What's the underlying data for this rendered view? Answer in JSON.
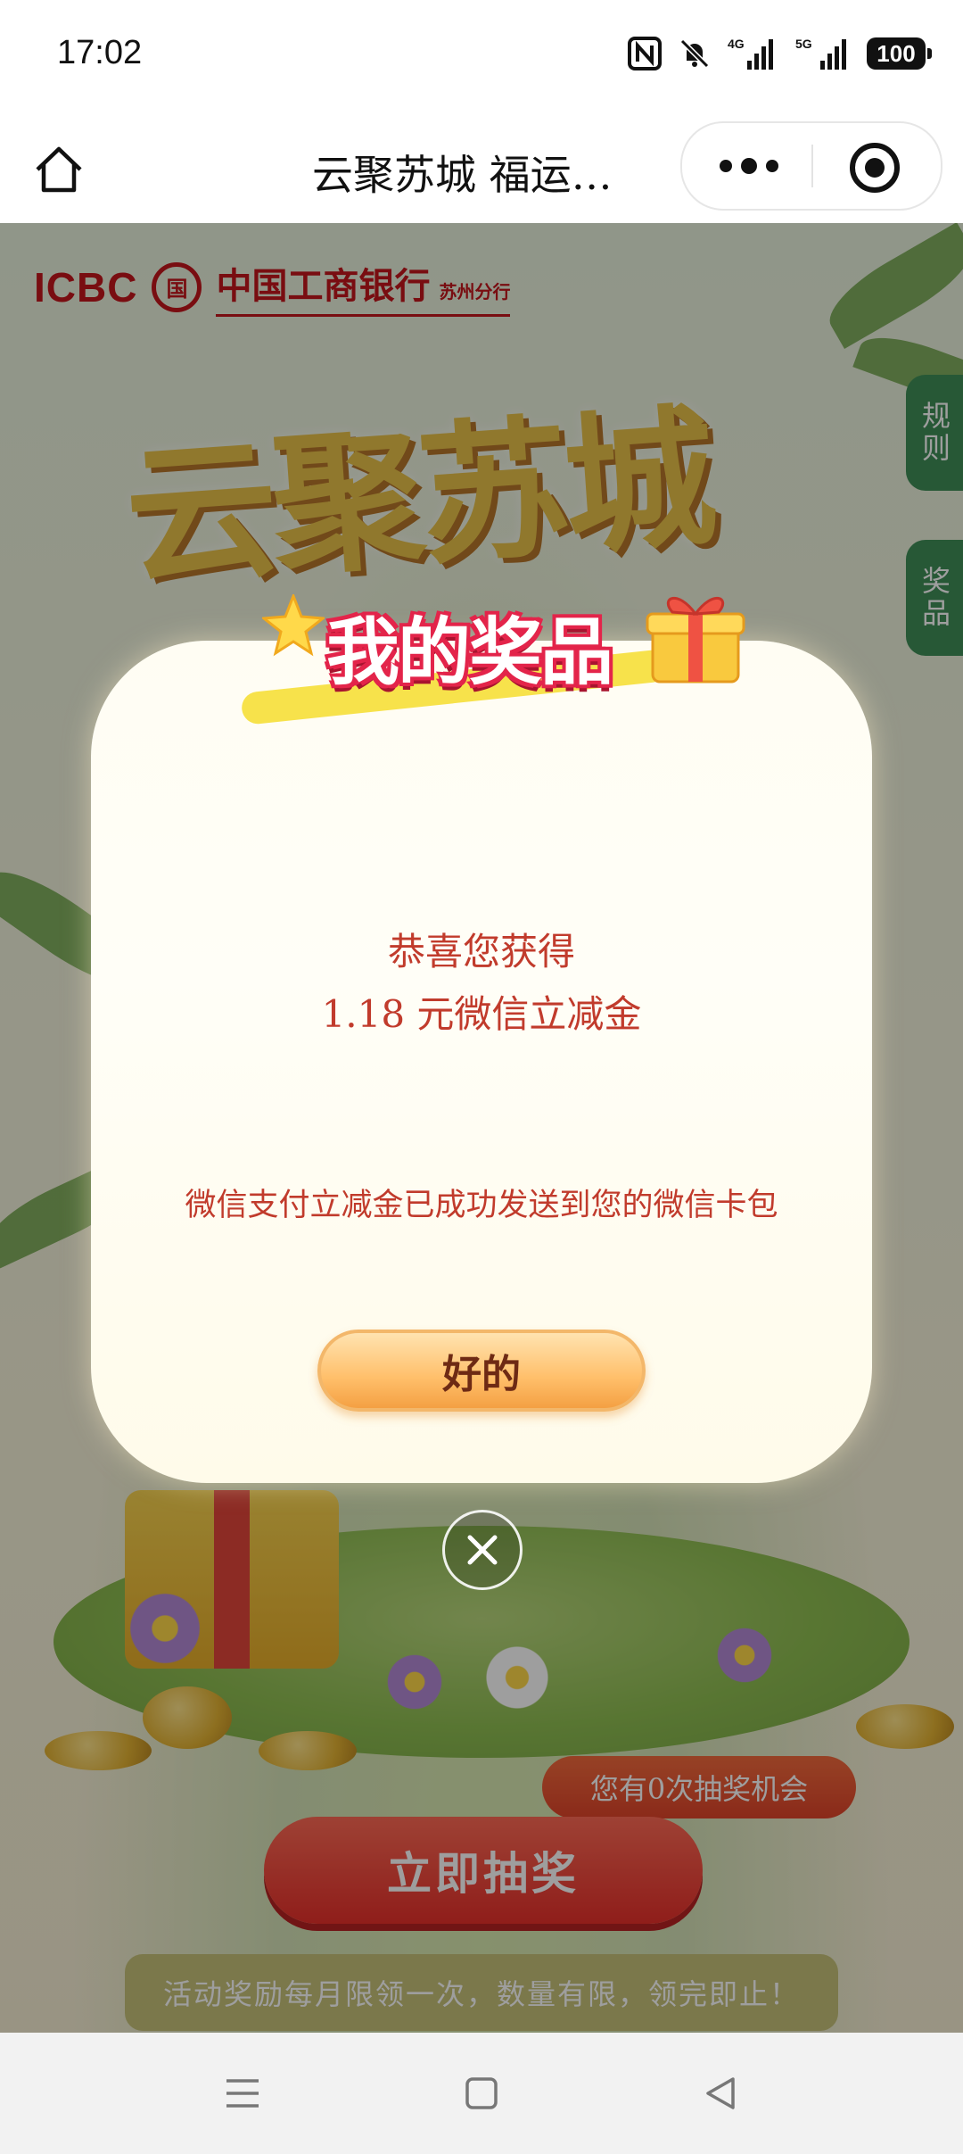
{
  "status_bar": {
    "time": "17:02",
    "icons": [
      "nfc-icon",
      "mute-bell-icon",
      "signal-4g-icon",
      "signal-5g-icon"
    ],
    "network_4g": "4G",
    "network_5g": "5G",
    "battery": "100"
  },
  "nav": {
    "title": "云聚苏城 福运…",
    "home_icon": "home-icon",
    "more_icon": "more-dots-icon",
    "target_icon": "target-icon"
  },
  "page": {
    "bank_en": "ICBC",
    "bank_mark": "国",
    "bank_cn": "中国工商银行",
    "bank_branch": "苏州分行",
    "campaign_title": "云聚苏城",
    "side_rules": "规则",
    "side_prizes": "奖品",
    "chance_text": "您有0次抽奖机会",
    "draw_button": "立即抽奖",
    "notice": "活动奖励每月限领一次，数量有限，领完即止！"
  },
  "modal": {
    "title": "我的奖品",
    "congrats_line1": "恭喜您获得",
    "congrats_line2": "1.18 元微信立减金",
    "sent_note": "微信支付立减金已成功发送到您的微信卡包",
    "ok_button": "好的",
    "close_icon": "close-icon"
  },
  "colors": {
    "modal_text": "#c13b2c",
    "bank_red": "#c3151c",
    "draw_button": "#e8302b",
    "side_tab": "#3f8f58"
  },
  "android_nav": {
    "menu_icon": "menu-icon",
    "home_icon": "square-home-icon",
    "back_icon": "back-triangle-icon"
  }
}
